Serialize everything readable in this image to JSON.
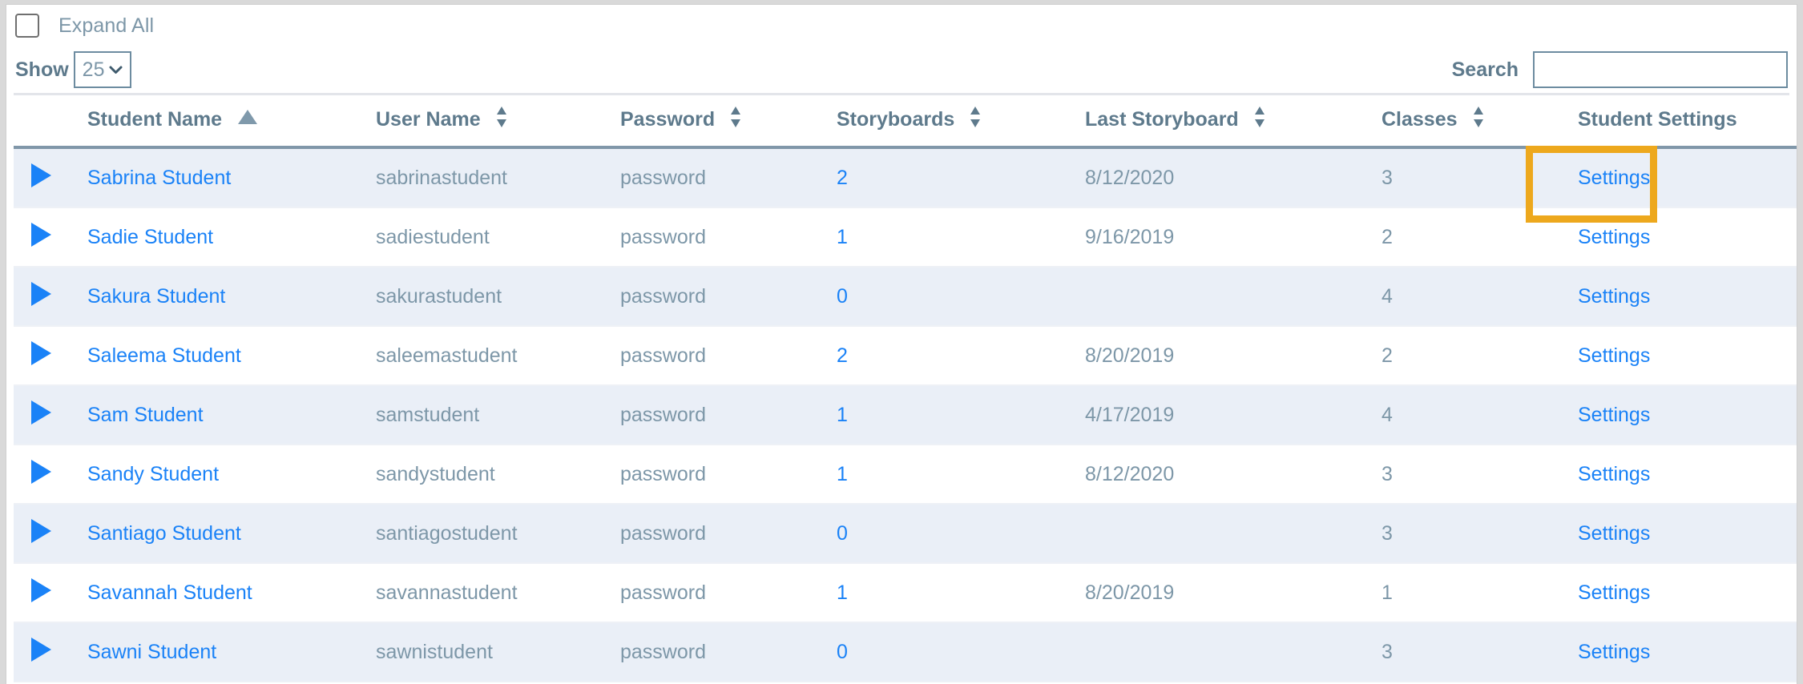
{
  "controls": {
    "expand_all_label": "Expand All",
    "expand_all_checked": false,
    "show_label": "Show",
    "page_size_value": "25",
    "page_size_options": [
      "25"
    ],
    "search_label": "Search",
    "search_value": "",
    "search_placeholder": ""
  },
  "colors": {
    "link": "#1a82f7",
    "header_text": "#5e7a8c",
    "body_text": "#7d97a8",
    "row_stripe": "#eaeff7",
    "highlight": "#eda81d",
    "header_rule": "#8097a9"
  },
  "table": {
    "columns": [
      {
        "key": "expand",
        "label": "",
        "sort": "none"
      },
      {
        "key": "name",
        "label": "Student Name",
        "sort": "asc"
      },
      {
        "key": "user",
        "label": "User Name",
        "sort": "both"
      },
      {
        "key": "password",
        "label": "Password",
        "sort": "both"
      },
      {
        "key": "story",
        "label": "Storyboards",
        "sort": "both"
      },
      {
        "key": "last",
        "label": "Last Storyboard",
        "sort": "both"
      },
      {
        "key": "classes",
        "label": "Classes",
        "sort": "both"
      },
      {
        "key": "settings",
        "label": "Student Settings",
        "sort": "none"
      }
    ],
    "settings_link_label": "Settings",
    "rows": [
      {
        "name": "Sabrina Student",
        "user": "sabrinastudent",
        "password": "password",
        "storyboards": "2",
        "last_storyboard": "8/12/2020",
        "classes": "3",
        "settings": "Settings"
      },
      {
        "name": "Sadie Student",
        "user": "sadiestudent",
        "password": "password",
        "storyboards": "1",
        "last_storyboard": "9/16/2019",
        "classes": "2",
        "settings": "Settings"
      },
      {
        "name": "Sakura Student",
        "user": "sakurastudent",
        "password": "password",
        "storyboards": "0",
        "last_storyboard": "",
        "classes": "4",
        "settings": "Settings"
      },
      {
        "name": "Saleema Student",
        "user": "saleemastudent",
        "password": "password",
        "storyboards": "2",
        "last_storyboard": "8/20/2019",
        "classes": "2",
        "settings": "Settings"
      },
      {
        "name": "Sam Student",
        "user": "samstudent",
        "password": "password",
        "storyboards": "1",
        "last_storyboard": "4/17/2019",
        "classes": "4",
        "settings": "Settings"
      },
      {
        "name": "Sandy Student",
        "user": "sandystudent",
        "password": "password",
        "storyboards": "1",
        "last_storyboard": "8/12/2020",
        "classes": "3",
        "settings": "Settings"
      },
      {
        "name": "Santiago Student",
        "user": "santiagostudent",
        "password": "password",
        "storyboards": "0",
        "last_storyboard": "",
        "classes": "3",
        "settings": "Settings"
      },
      {
        "name": "Savannah Student",
        "user": "savannastudent",
        "password": "password",
        "storyboards": "1",
        "last_storyboard": "8/20/2019",
        "classes": "1",
        "settings": "Settings"
      },
      {
        "name": "Sawni Student",
        "user": "sawnistudent",
        "password": "password",
        "storyboards": "0",
        "last_storyboard": "",
        "classes": "3",
        "settings": "Settings"
      }
    ]
  },
  "highlight": {
    "target": "settings-link-row-1"
  }
}
